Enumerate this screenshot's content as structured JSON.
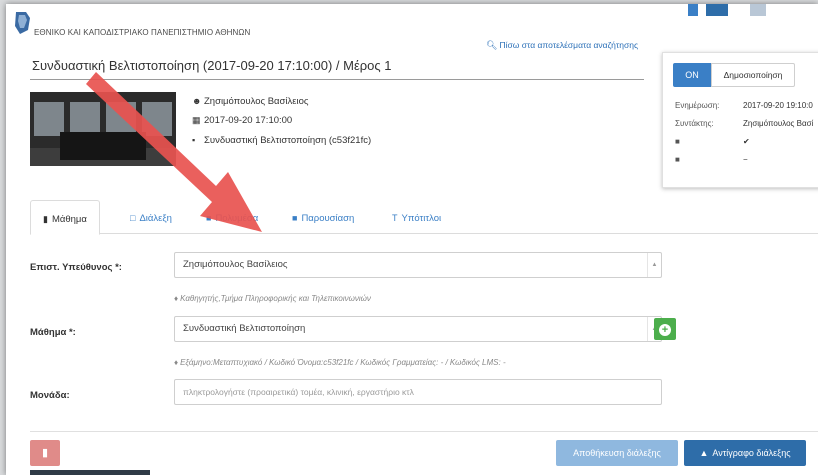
{
  "header": {
    "university": "ΕΘΝΙΚΟ ΚΑΙ ΚΑΠΟΔΙΣΤΡΙΑΚΟ ΠΑΝΕΠΙΣΤΗΜΙΟ ΑΘΗΝΩΝ",
    "back_link": "Πίσω στα αποτελέσματα αναζήτησης",
    "title": "Συνδυαστική Βελτιστοποίηση (2017-09-20 17:10:00)  / Μέρος 1"
  },
  "lecture_meta": {
    "lecturer": "Ζησιμόπουλος Βασίλειος",
    "datetime": "2017-09-20   17:10:00",
    "course": "Συνδυαστική Βελτιστοποίηση (c53f21fc)"
  },
  "side_panel": {
    "on_label": "ON",
    "publish_label": "Δημοσιοποίηση",
    "updated_label": "Ενημέρωση:",
    "updated_value": "2017-09-20 19:10:0",
    "author_label": "Συντάκτης:",
    "author_value": "Ζησιμόπουλος Βασί",
    "video_value": "✔",
    "presentation_value": "−"
  },
  "tabs": [
    {
      "label": "Μάθημα",
      "icon": "book-icon"
    },
    {
      "label": "Διάλεξη",
      "icon": "chat-icon"
    },
    {
      "label": "Πολυμέσα",
      "icon": "video-icon"
    },
    {
      "label": "Παρουσίαση",
      "icon": "presentation-icon"
    },
    {
      "label": "Υπότιτλοι",
      "icon": "text-icon"
    }
  ],
  "form": {
    "supervisor_label": "Επιστ. Υπεύθυνος *:",
    "supervisor_value": "Ζησιμόπουλος Βασίλειος",
    "supervisor_hint": "Καθηγητής,Τμήμα Πληροφορικής και Τηλεπικοινωνιών",
    "course_label": "Μάθημα *:",
    "course_value": "Συνδυαστική Βελτιστοποίηση",
    "course_hint": "Εξάμηνο:Μεταπτυχιακό / Κωδικό Όνομα:c53f21fc / Κωδικός Γραμματείας: - / Κωδικός LMS: -",
    "unit_label": "Μονάδα:",
    "unit_placeholder": "πληκτρολογήστε (προαιρετικά) τομέα, κλινική, εργαστήριο κτλ"
  },
  "buttons": {
    "save": "Αποθήκευση διάλεξης",
    "copy": "Αντίγραφο διάλεξης"
  },
  "colors": {
    "accent": "#3a7fc6",
    "danger": "#e08b89",
    "success": "#4cae4c",
    "arrow": "#e8534f"
  }
}
